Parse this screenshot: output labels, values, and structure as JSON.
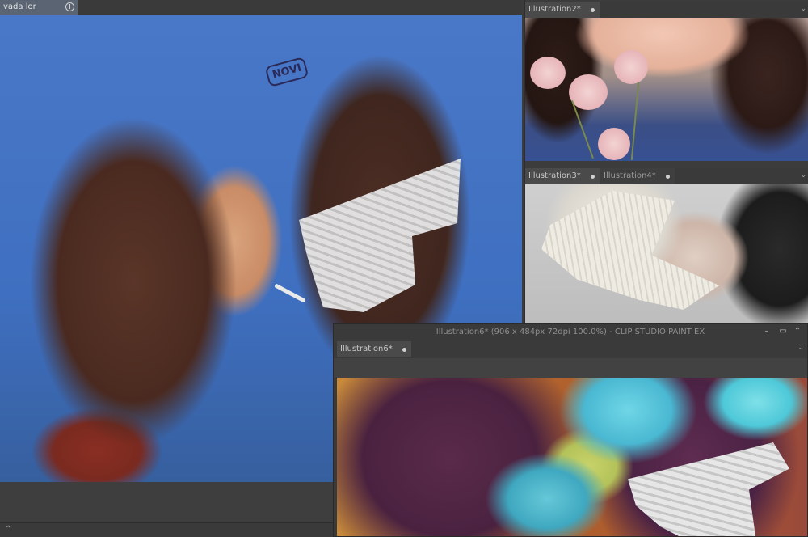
{
  "main_window": {
    "tab_label": "vada lor",
    "signature": "NOVI"
  },
  "window_top_right": {
    "tab_label": "Illustration2*"
  },
  "window_mid_right": {
    "tabs": [
      {
        "label": "Illustration3*"
      },
      {
        "label": "Illustration4*"
      }
    ]
  },
  "floating_window": {
    "title": "Illustration6* (906 x 484px 72dpi 100.0%)  - CLIP STUDIO PAINT EX",
    "tab_label": "Illustration6*",
    "controls": [
      "minimize",
      "maximize",
      "close"
    ]
  },
  "icons": {
    "download": "download-icon",
    "collapse": "chevron-up-double-icon",
    "dropdown": "chevron-down-icon"
  },
  "colors": {
    "app_background": "#3c3c3c",
    "active_tab": "#5a6472",
    "canvas_blue": "#4a78c8"
  }
}
